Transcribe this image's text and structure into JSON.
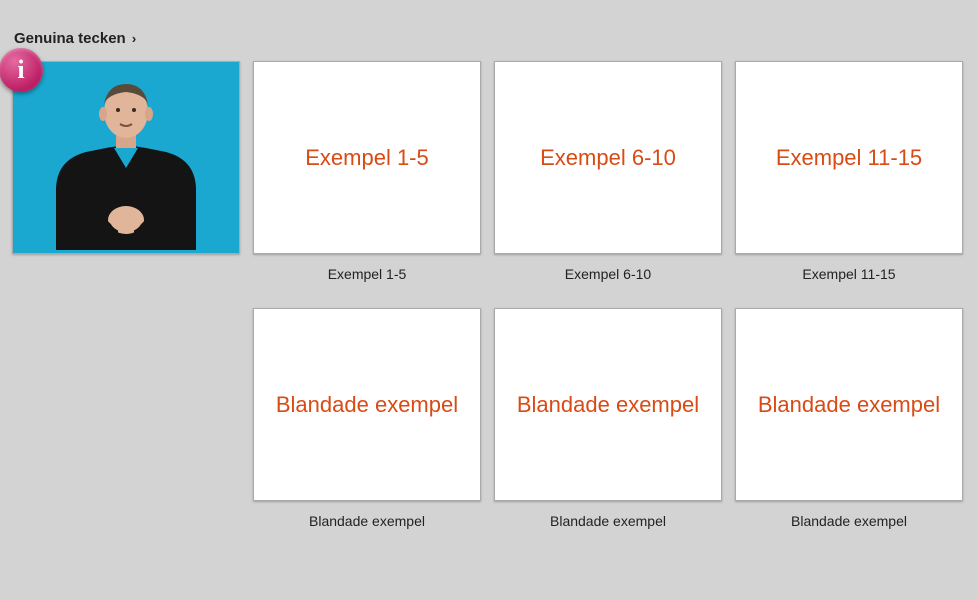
{
  "breadcrumb": {
    "label": "Genuina tecken"
  },
  "info_badge": {
    "glyph": "i"
  },
  "tiles": [
    {
      "title": "Exempel 1-5",
      "caption": "Exempel 1-5"
    },
    {
      "title": "Exempel 6-10",
      "caption": "Exempel 6-10"
    },
    {
      "title": "Exempel 11-15",
      "caption": "Exempel 11-15"
    },
    {
      "title": "Blandade exempel",
      "caption": "Blandade exempel"
    },
    {
      "title": "Blandade exempel",
      "caption": "Blandade exempel"
    },
    {
      "title": "Blandade exempel",
      "caption": "Blandade exempel"
    }
  ]
}
